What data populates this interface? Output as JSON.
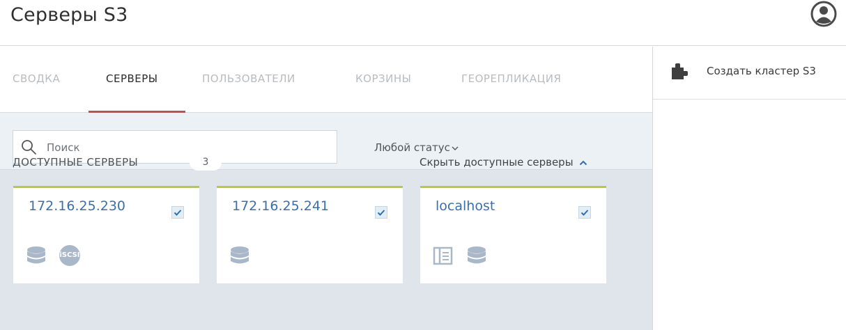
{
  "header": {
    "title": "Серверы S3",
    "user_icon": "user-circle-icon"
  },
  "tabs": [
    {
      "label": "СВОДКА",
      "active": false
    },
    {
      "label": "СЕРВЕРЫ",
      "active": true
    },
    {
      "label": "ПОЛЬЗОВАТЕЛИ",
      "active": false
    },
    {
      "label": "КОРЗИНЫ",
      "active": false
    },
    {
      "label": "ГЕОРЕПЛИКАЦИЯ",
      "active": false
    }
  ],
  "filters": {
    "search_placeholder": "Поиск",
    "status_filter": "Любой статус"
  },
  "available": {
    "title": "ДОСТУПНЫЕ СЕРВЕРЫ",
    "count": "3",
    "hide_label": "Скрыть доступные серверы"
  },
  "servers": [
    {
      "name": "172.16.25.230",
      "checked": true,
      "icons": [
        "storage-disk-icon",
        "iscsi-icon"
      ]
    },
    {
      "name": "172.16.25.241",
      "checked": true,
      "icons": [
        "storage-disk-icon"
      ]
    },
    {
      "name": "localhost",
      "checked": true,
      "icons": [
        "metadata-panel-icon",
        "storage-disk-icon"
      ]
    }
  ],
  "iscsi_text": "iSCSI",
  "sidebar": {
    "action_label": "Создать кластер S3",
    "action_icon": "puzzle-icon"
  },
  "colors": {
    "active_tab_underline": "#d04a4a",
    "card_top_border": "#b6cc2f",
    "link_blue": "#3a6fae",
    "main_bg": "#dfe5ea"
  }
}
